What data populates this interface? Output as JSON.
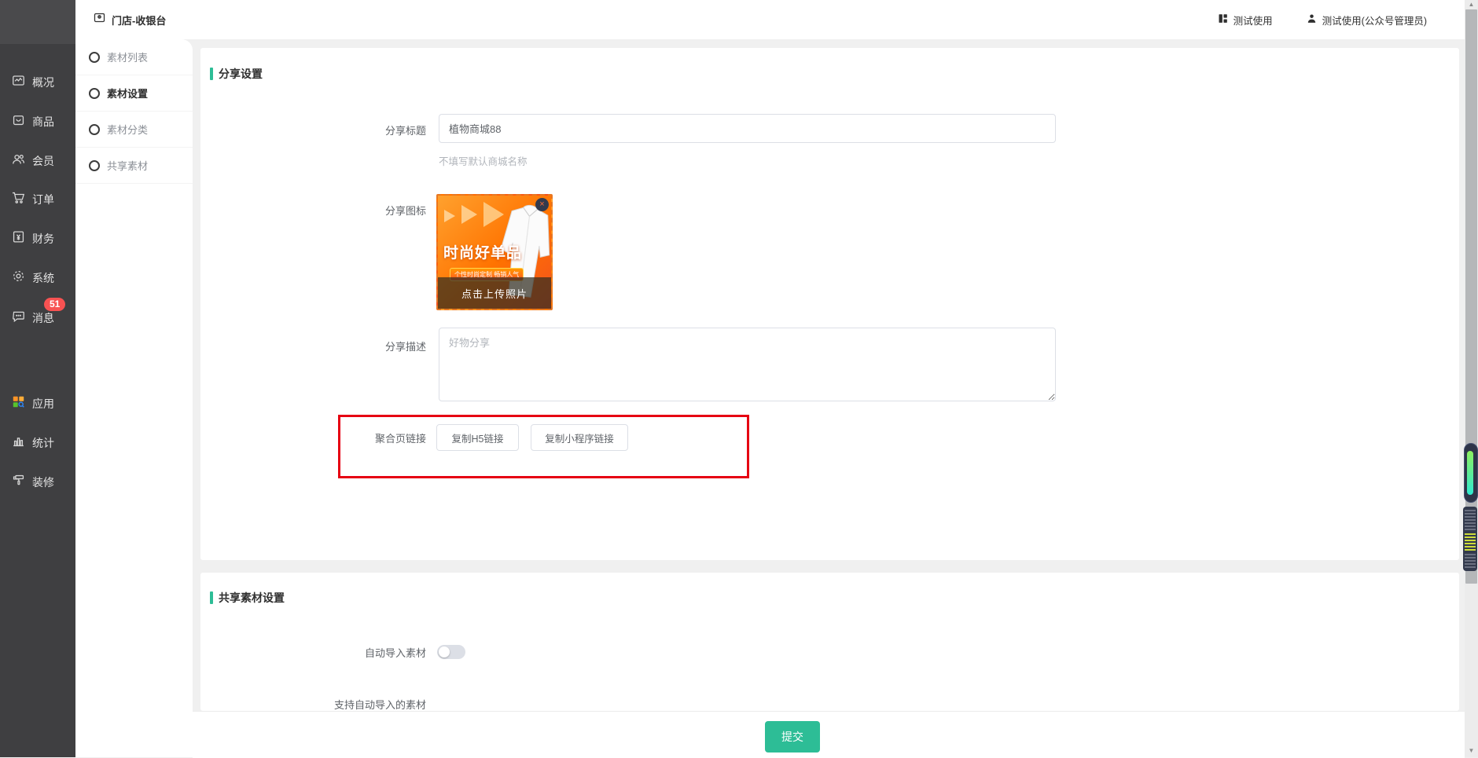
{
  "topbar": {
    "title": "门店-收银台",
    "user_actions": [
      {
        "label": "测试使用"
      },
      {
        "label": "测试使用(公众号管理员)"
      }
    ]
  },
  "sidebar": {
    "items": [
      {
        "label": "概况"
      },
      {
        "label": "商品"
      },
      {
        "label": "会员"
      },
      {
        "label": "订单"
      },
      {
        "label": "财务"
      },
      {
        "label": "系统"
      },
      {
        "label": "消息",
        "badge": "51"
      },
      {
        "label": "应用"
      },
      {
        "label": "统计"
      },
      {
        "label": "装修"
      }
    ]
  },
  "subnav": {
    "items": [
      {
        "label": "素材列表",
        "active": false
      },
      {
        "label": "素材设置",
        "active": true
      },
      {
        "label": "素材分类",
        "active": false
      },
      {
        "label": "共享素材",
        "active": false
      }
    ]
  },
  "share_section": {
    "title": "分享设置",
    "share_title": {
      "label": "分享标题",
      "value": "植物商城88",
      "hint": "不填写默认商城名称"
    },
    "share_icon": {
      "label": "分享图标",
      "image_headline": "时尚好单品",
      "image_ribbon": "个性时尚定制 畅销人气",
      "upload_overlay": "点击上传照片",
      "close_glyph": "×"
    },
    "share_desc": {
      "label": "分享描述",
      "placeholder": "好物分享"
    },
    "aggregate_link": {
      "label": "聚合页链接",
      "copy_h5": "复制H5链接",
      "copy_mini": "复制小程序链接"
    }
  },
  "shared_material_section": {
    "title": "共享素材设置",
    "auto_import": {
      "label": "自动导入素材",
      "enabled": false
    },
    "support_label": "支持自动导入的素材"
  },
  "footer": {
    "submit_label": "提交"
  },
  "scrollbar": {
    "up_glyph": "▲",
    "down_glyph": "▼"
  },
  "colors": {
    "accent": "#2dbd96",
    "badge_red": "#f85252",
    "annotation_red": "#e60012",
    "sidebar_bg": "#3f3f41"
  }
}
